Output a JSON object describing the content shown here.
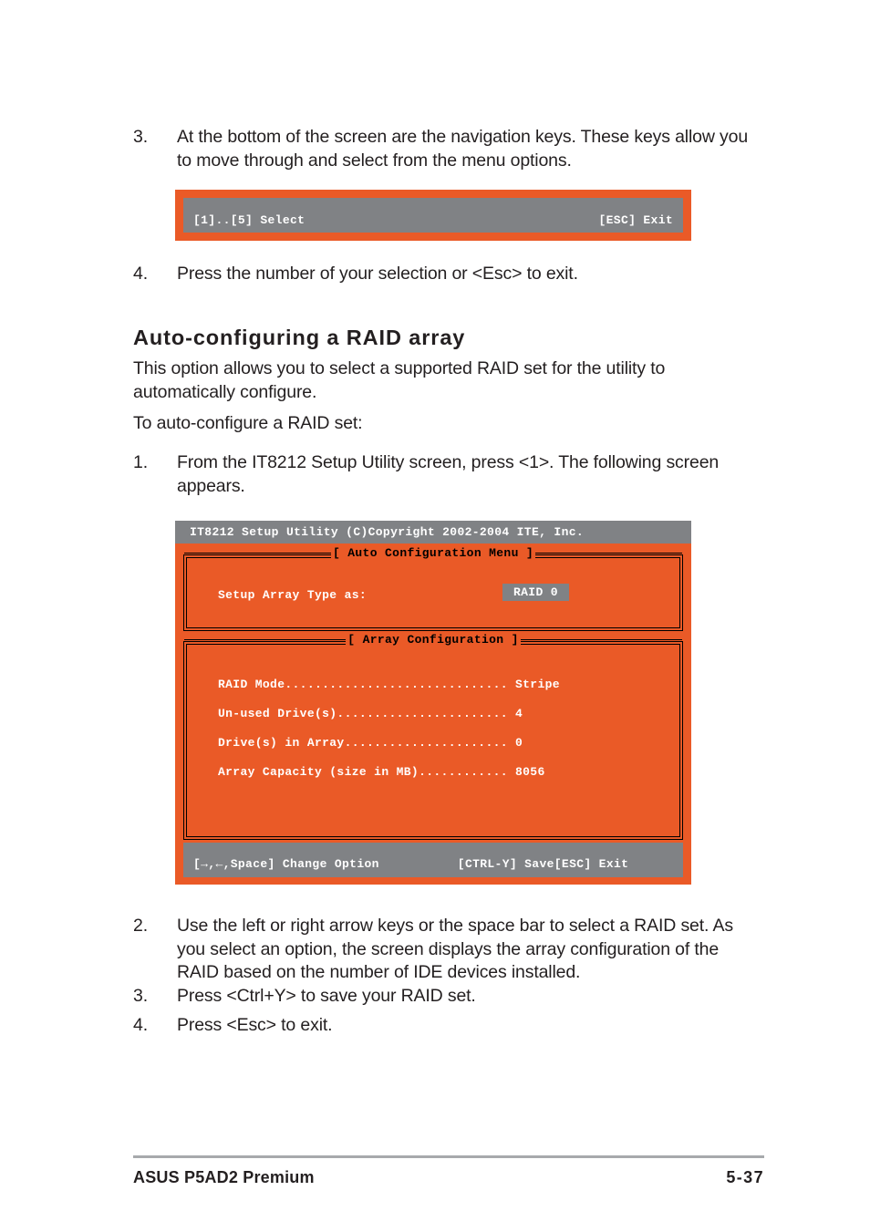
{
  "doc": {
    "steps_top": [
      {
        "num": "3.",
        "text": "At the bottom of the screen are the navigation keys. These keys allow you to move through and select from the menu options."
      },
      {
        "num": "4.",
        "text": "Press the number of your selection or <Esc> to exit."
      }
    ],
    "heading": "Auto-configuring a RAID array",
    "intro_paragraph": "This option allows you to select a supported RAID set for the utility to automatically configure.",
    "lead_in": "To auto-configure a RAID set:",
    "steps_bottom": [
      {
        "num": "1.",
        "text": "From the IT8212 Setup Utility screen, press <1>. The following screen appears."
      },
      {
        "num": "2.",
        "text": "Use the left or right arrow keys or the space bar to select a RAID set. As you select an option, the screen displays the array configuration of the RAID based on the number of IDE devices installed."
      },
      {
        "num": "3.",
        "text": "Press <Ctrl+Y> to save your RAID set."
      },
      {
        "num": "4.",
        "text": "Press <Esc> to exit."
      }
    ]
  },
  "nav_keys_screen": {
    "select_hint": "[1]..[5] Select",
    "exit_hint": "[ESC] Exit"
  },
  "auto_config_screen": {
    "title_bar": "IT8212 Setup Utility (C)Copyright 2002-2004 ITE, Inc.",
    "auto_panel": {
      "title": "[ Auto Configuration Menu ]",
      "field_label": "Setup Array Type as:",
      "field_value": "RAID 0"
    },
    "array_panel": {
      "title": "[ Array Configuration ]",
      "rows": [
        {
          "label": "RAID Mode",
          "dots": "..............................",
          "value": "Stripe"
        },
        {
          "label": "Un-used Drive(s)",
          "dots": ".......................",
          "value": "4"
        },
        {
          "label": "Drive(s) in Array",
          "dots": "......................",
          "value": "0"
        },
        {
          "label": "Array Capacity (size in MB)",
          "dots": "............",
          "value": "8056"
        }
      ]
    },
    "footer_bar": {
      "change_option": "[→,←,Space] Change Option",
      "save": "[CTRL-Y] Save",
      "exit": "[ESC] Exit"
    }
  },
  "footer": {
    "product": "ASUS P5AD2 Premium",
    "page_number": "5-37"
  },
  "colors": {
    "bios_orange": "#ea5a27",
    "bios_gray": "#808285",
    "bios_text": "#ffffff",
    "border_black": "#000000",
    "footer_rule": "#a7a9ac",
    "body_text": "#231f20"
  }
}
